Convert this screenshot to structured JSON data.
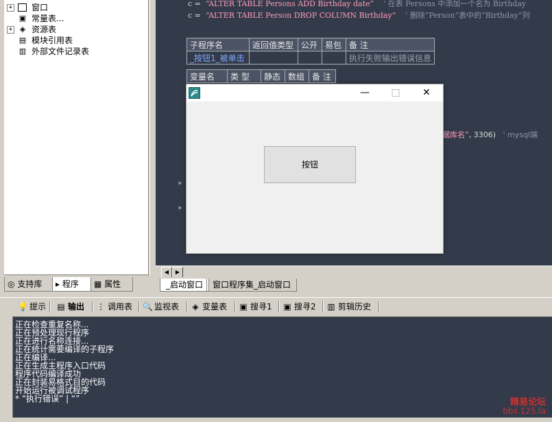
{
  "tree": {
    "items": [
      {
        "label": "窗口",
        "expander": "+",
        "icon": "window-icon"
      },
      {
        "label": "常量表...",
        "expander": "",
        "icon": "constants-icon"
      },
      {
        "label": "资源表",
        "expander": "+",
        "icon": "resource-icon"
      },
      {
        "label": "模块引用表",
        "expander": "",
        "icon": "module-icon"
      },
      {
        "label": "外部文件记录表",
        "expander": "",
        "icon": "file-record-icon"
      }
    ]
  },
  "left_tabs": {
    "support": "支持库",
    "program": "程序",
    "property": "属性"
  },
  "code": {
    "line1": {
      "prefix": "c =",
      "string": "“ALTER TABLE Persons ADD Birthday date”",
      "comment": "' 在表 Persons 中添加一个名为 Birthday"
    },
    "line2": {
      "prefix": "c =",
      "string": "“ALTER TABLE Person DROP COLUMN Birthday”",
      "comment": "' 删除“Person”表中的“Birthday”列"
    },
    "line3": {
      "string": "据库名”",
      "mid": ", 3306)",
      "comment": "' mysql端"
    },
    "sub_table": {
      "headers": [
        "子程序名",
        "返回值类型",
        "公开",
        "易包",
        "备 注"
      ],
      "row": [
        "_按钮1_被单击",
        "",
        "",
        "",
        "执行失败输出错误信息"
      ]
    },
    "var_table": {
      "headers": [
        "变量名",
        "类 型",
        "静态",
        "数组",
        "备 注"
      ]
    },
    "markers": [
      "»",
      "»"
    ]
  },
  "doc_tabs": {
    "tab1": "_启动窗口",
    "tab2": "窗口程序集_启动窗口"
  },
  "output_tabs": [
    {
      "label": "提示",
      "icon": "hint-icon"
    },
    {
      "label": "输出",
      "icon": "output-icon"
    },
    {
      "label": "调用表",
      "icon": "callstack-icon"
    },
    {
      "label": "监视表",
      "icon": "watch-icon"
    },
    {
      "label": "变量表",
      "icon": "variables-icon"
    },
    {
      "label": "搜寻1",
      "icon": "search1-icon"
    },
    {
      "label": "搜寻2",
      "icon": "search2-icon"
    },
    {
      "label": "剪辑历史",
      "icon": "clipboard-history-icon"
    }
  ],
  "output_lines": [
    "正在检查重复名称...",
    "正在预处理现行程序",
    "正在进行名称连接...",
    "正在统计需要编译的子程序",
    "正在编译...",
    "正在生成主程序入口代码",
    "程序代码编译成功",
    "正在封装易格式目的代码",
    "开始运行被调试程序",
    "* “执行错误” | “”"
  ],
  "watermark": {
    "line1": "精易论坛",
    "line2": "bbs.125.la"
  },
  "dialog": {
    "button_label": "按钮",
    "minimize": "—",
    "maximize": "□",
    "close": "✕"
  },
  "colors": {
    "code_bg": "#333b4a",
    "string": "#ff9ab8",
    "comment": "#8e97a6"
  }
}
